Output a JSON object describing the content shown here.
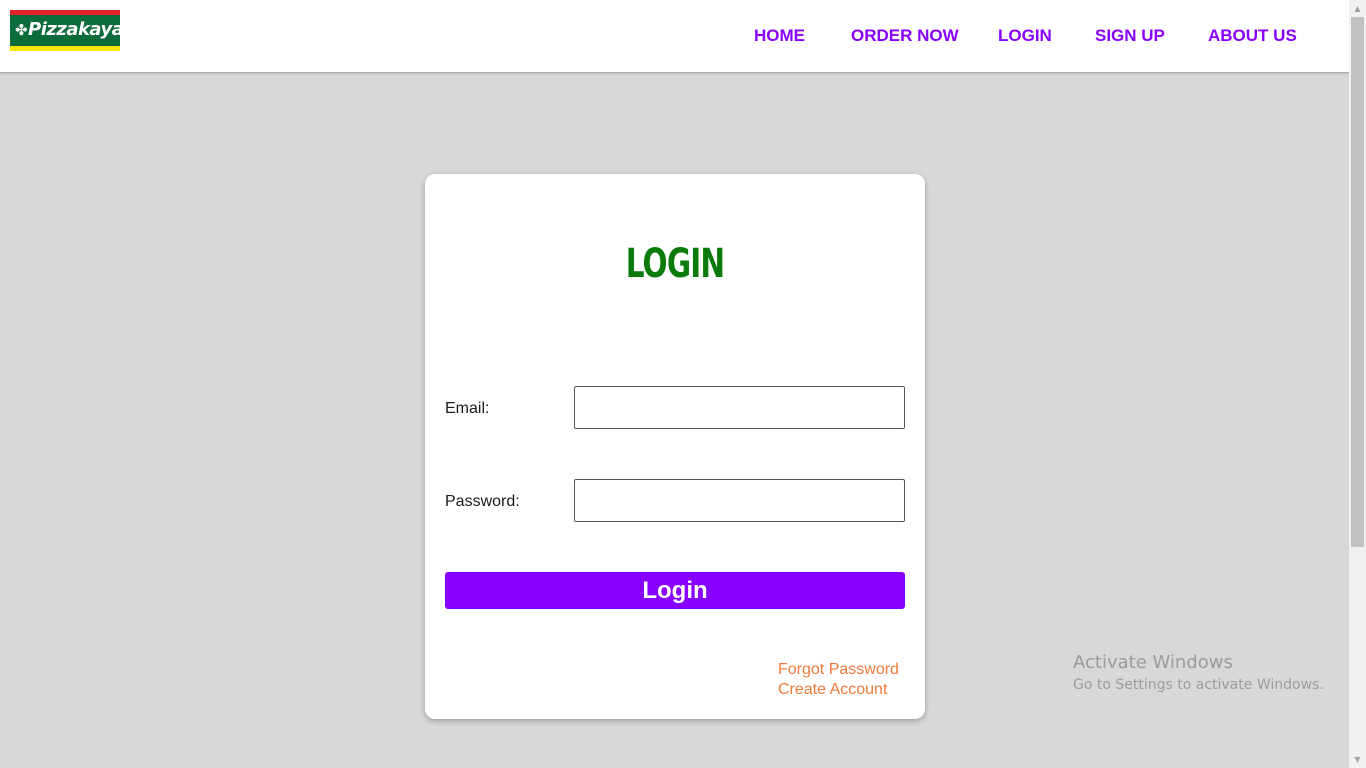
{
  "brand": {
    "logo_text": "Pizzakaya",
    "logo_icon": "clover-leaf-icon",
    "colors": {
      "green": "#0b6b3a",
      "red": "#e2232a",
      "yellow": "#f4e400"
    }
  },
  "nav": {
    "items": [
      {
        "label": "HOME"
      },
      {
        "label": "ORDER NOW"
      },
      {
        "label": "LOGIN"
      },
      {
        "label": "SIGN UP"
      },
      {
        "label": "ABOUT US"
      }
    ],
    "color": "#8800ff"
  },
  "login_card": {
    "title": "LOGIN",
    "email_label": "Email:",
    "email_value": "",
    "password_label": "Password:",
    "password_value": "",
    "submit_label": "Login",
    "forgot_password_link": "Forgot Password",
    "create_account_link": "Create Account",
    "title_color": "#0a7a0a",
    "button_color": "#8800ff",
    "link_color": "#f07a3a"
  },
  "watermark": {
    "title": "Activate Windows",
    "subtitle": "Go to Settings to activate Windows."
  }
}
